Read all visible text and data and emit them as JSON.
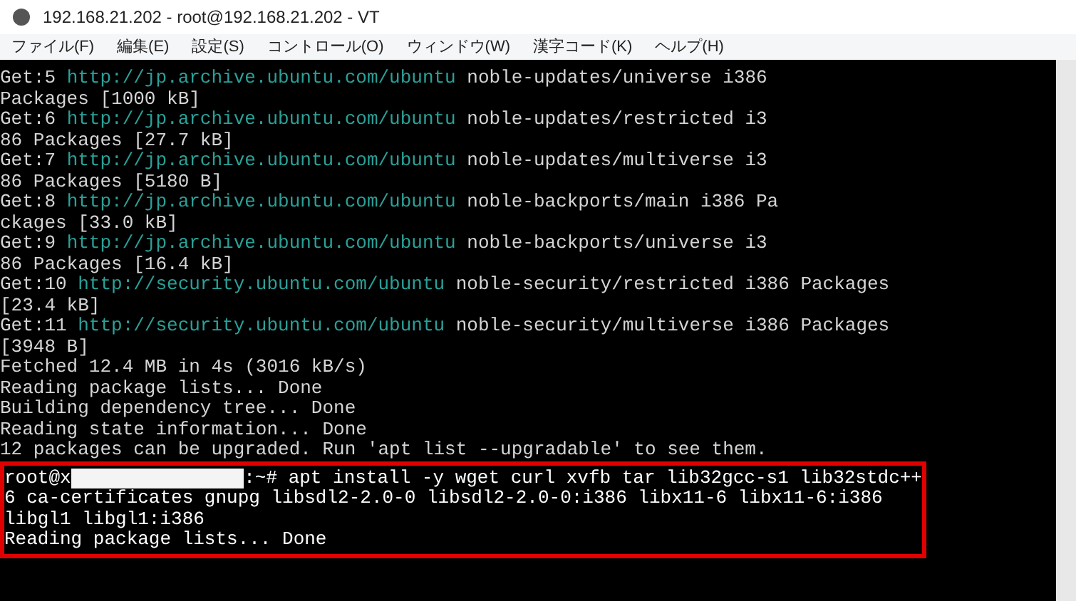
{
  "window": {
    "title": "192.168.21.202 - root@192.168.21.202 - VT"
  },
  "menu": [
    "ファイル(F)",
    "編集(E)",
    "設定(S)",
    "コントロール(O)",
    "ウィンドウ(W)",
    "漢字コード(K)",
    "ヘルプ(H)"
  ],
  "terminal": {
    "lines": [
      [
        {
          "kind": "plain",
          "text": "Get:5 "
        },
        {
          "kind": "url",
          "text": "http://jp.archive.ubuntu.com/ubuntu"
        },
        {
          "kind": "plain",
          "text": " noble-updates/universe i386"
        }
      ],
      [
        {
          "kind": "plain",
          "text": "Packages [1000 kB]"
        }
      ],
      [
        {
          "kind": "plain",
          "text": "Get:6 "
        },
        {
          "kind": "url",
          "text": "http://jp.archive.ubuntu.com/ubuntu"
        },
        {
          "kind": "plain",
          "text": " noble-updates/restricted i3"
        }
      ],
      [
        {
          "kind": "plain",
          "text": "86 Packages [27.7 kB]"
        }
      ],
      [
        {
          "kind": "plain",
          "text": "Get:7 "
        },
        {
          "kind": "url",
          "text": "http://jp.archive.ubuntu.com/ubuntu"
        },
        {
          "kind": "plain",
          "text": " noble-updates/multiverse i3"
        }
      ],
      [
        {
          "kind": "plain",
          "text": "86 Packages [5180 B]"
        }
      ],
      [
        {
          "kind": "plain",
          "text": "Get:8 "
        },
        {
          "kind": "url",
          "text": "http://jp.archive.ubuntu.com/ubuntu"
        },
        {
          "kind": "plain",
          "text": " noble-backports/main i386 Pa"
        }
      ],
      [
        {
          "kind": "plain",
          "text": "ckages [33.0 kB]"
        }
      ],
      [
        {
          "kind": "plain",
          "text": "Get:9 "
        },
        {
          "kind": "url",
          "text": "http://jp.archive.ubuntu.com/ubuntu"
        },
        {
          "kind": "plain",
          "text": " noble-backports/universe i3"
        }
      ],
      [
        {
          "kind": "plain",
          "text": "86 Packages [16.4 kB]"
        }
      ],
      [
        {
          "kind": "plain",
          "text": "Get:10 "
        },
        {
          "kind": "url",
          "text": "http://security.ubuntu.com/ubuntu"
        },
        {
          "kind": "plain",
          "text": " noble-security/restricted i386 Packages"
        }
      ],
      [
        {
          "kind": "plain",
          "text": "[23.4 kB]"
        }
      ],
      [
        {
          "kind": "plain",
          "text": "Get:11 "
        },
        {
          "kind": "url",
          "text": "http://security.ubuntu.com/ubuntu"
        },
        {
          "kind": "plain",
          "text": " noble-security/multiverse i386 Packages"
        }
      ],
      [
        {
          "kind": "plain",
          "text": "[3948 B]"
        }
      ],
      [
        {
          "kind": "plain",
          "text": "Fetched 12.4 MB in 4s (3016 kB/s)"
        }
      ],
      [
        {
          "kind": "plain",
          "text": "Reading package lists... Done"
        }
      ],
      [
        {
          "kind": "plain",
          "text": "Building dependency tree... Done"
        }
      ],
      [
        {
          "kind": "plain",
          "text": "Reading state information... Done"
        }
      ],
      [
        {
          "kind": "plain",
          "text": "12 packages can be upgraded. Run 'apt list --upgradable' to see them."
        }
      ]
    ]
  },
  "highlighted_block": {
    "lines": [
      [
        {
          "kind": "plain",
          "text": "root@x"
        },
        {
          "kind": "redacted"
        },
        {
          "kind": "plain",
          "text": ":~# apt install -y wget curl xvfb tar lib32gcc-s1 lib32stdc++"
        }
      ],
      [
        {
          "kind": "plain",
          "text": "6 ca-certificates gnupg libsdl2-2.0-0 libsdl2-2.0-0:i386 libx11-6 libx11-6:i386"
        }
      ],
      [
        {
          "kind": "plain",
          "text": "libgl1 libgl1:i386"
        }
      ],
      [
        {
          "kind": "plain",
          "text": "Reading package lists... Done"
        }
      ]
    ]
  }
}
